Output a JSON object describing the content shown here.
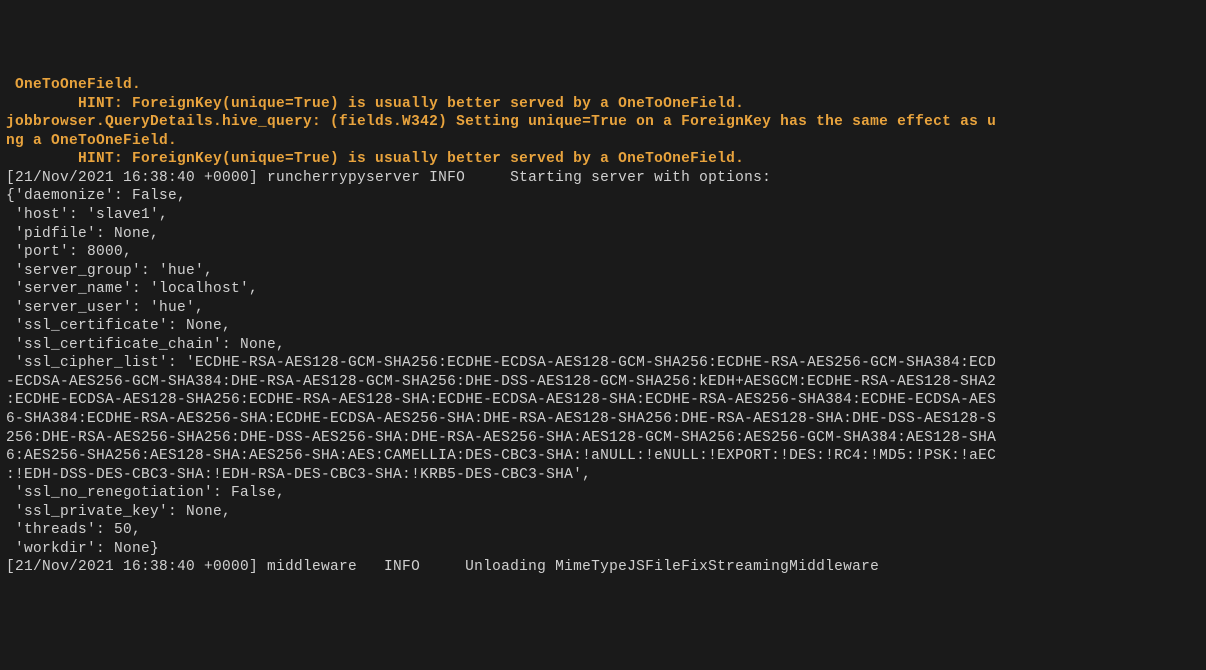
{
  "lines": [
    {
      "cls": "warn",
      "text": " OneToOneField."
    },
    {
      "cls": "warn",
      "text": "        HINT: ForeignKey(unique=True) is usually better served by a OneToOneField."
    },
    {
      "cls": "warn",
      "text": "jobbrowser.QueryDetails.hive_query: (fields.W342) Setting unique=True on a ForeignKey has the same effect as u"
    },
    {
      "cls": "warn",
      "text": "ng a OneToOneField."
    },
    {
      "cls": "warn",
      "text": "        HINT: ForeignKey(unique=True) is usually better served by a OneToOneField."
    },
    {
      "cls": "normal",
      "text": "[21/Nov/2021 16:38:40 +0000] runcherrypyserver INFO     Starting server with options:"
    },
    {
      "cls": "normal",
      "text": "{'daemonize': False,"
    },
    {
      "cls": "normal",
      "text": " 'host': 'slave1',"
    },
    {
      "cls": "normal",
      "text": " 'pidfile': None,"
    },
    {
      "cls": "normal",
      "text": " 'port': 8000,"
    },
    {
      "cls": "normal",
      "text": " 'server_group': 'hue',"
    },
    {
      "cls": "normal",
      "text": " 'server_name': 'localhost',"
    },
    {
      "cls": "normal",
      "text": " 'server_user': 'hue',"
    },
    {
      "cls": "normal",
      "text": " 'ssl_certificate': None,"
    },
    {
      "cls": "normal",
      "text": " 'ssl_certificate_chain': None,"
    },
    {
      "cls": "normal",
      "text": " 'ssl_cipher_list': 'ECDHE-RSA-AES128-GCM-SHA256:ECDHE-ECDSA-AES128-GCM-SHA256:ECDHE-RSA-AES256-GCM-SHA384:ECD"
    },
    {
      "cls": "normal",
      "text": "-ECDSA-AES256-GCM-SHA384:DHE-RSA-AES128-GCM-SHA256:DHE-DSS-AES128-GCM-SHA256:kEDH+AESGCM:ECDHE-RSA-AES128-SHA2"
    },
    {
      "cls": "normal",
      "text": ":ECDHE-ECDSA-AES128-SHA256:ECDHE-RSA-AES128-SHA:ECDHE-ECDSA-AES128-SHA:ECDHE-RSA-AES256-SHA384:ECDHE-ECDSA-AES"
    },
    {
      "cls": "normal",
      "text": "6-SHA384:ECDHE-RSA-AES256-SHA:ECDHE-ECDSA-AES256-SHA:DHE-RSA-AES128-SHA256:DHE-RSA-AES128-SHA:DHE-DSS-AES128-S"
    },
    {
      "cls": "normal",
      "text": "256:DHE-RSA-AES256-SHA256:DHE-DSS-AES256-SHA:DHE-RSA-AES256-SHA:AES128-GCM-SHA256:AES256-GCM-SHA384:AES128-SHA"
    },
    {
      "cls": "normal",
      "text": "6:AES256-SHA256:AES128-SHA:AES256-SHA:AES:CAMELLIA:DES-CBC3-SHA:!aNULL:!eNULL:!EXPORT:!DES:!RC4:!MD5:!PSK:!aEC"
    },
    {
      "cls": "normal",
      "text": ":!EDH-DSS-DES-CBC3-SHA:!EDH-RSA-DES-CBC3-SHA:!KRB5-DES-CBC3-SHA',"
    },
    {
      "cls": "normal",
      "text": " 'ssl_no_renegotiation': False,"
    },
    {
      "cls": "normal",
      "text": " 'ssl_private_key': None,"
    },
    {
      "cls": "normal",
      "text": " 'threads': 50,"
    },
    {
      "cls": "normal",
      "text": " 'workdir': None}"
    },
    {
      "cls": "normal",
      "text": "[21/Nov/2021 16:38:40 +0000] middleware   INFO     Unloading MimeTypeJSFileFixStreamingMiddleware"
    }
  ]
}
